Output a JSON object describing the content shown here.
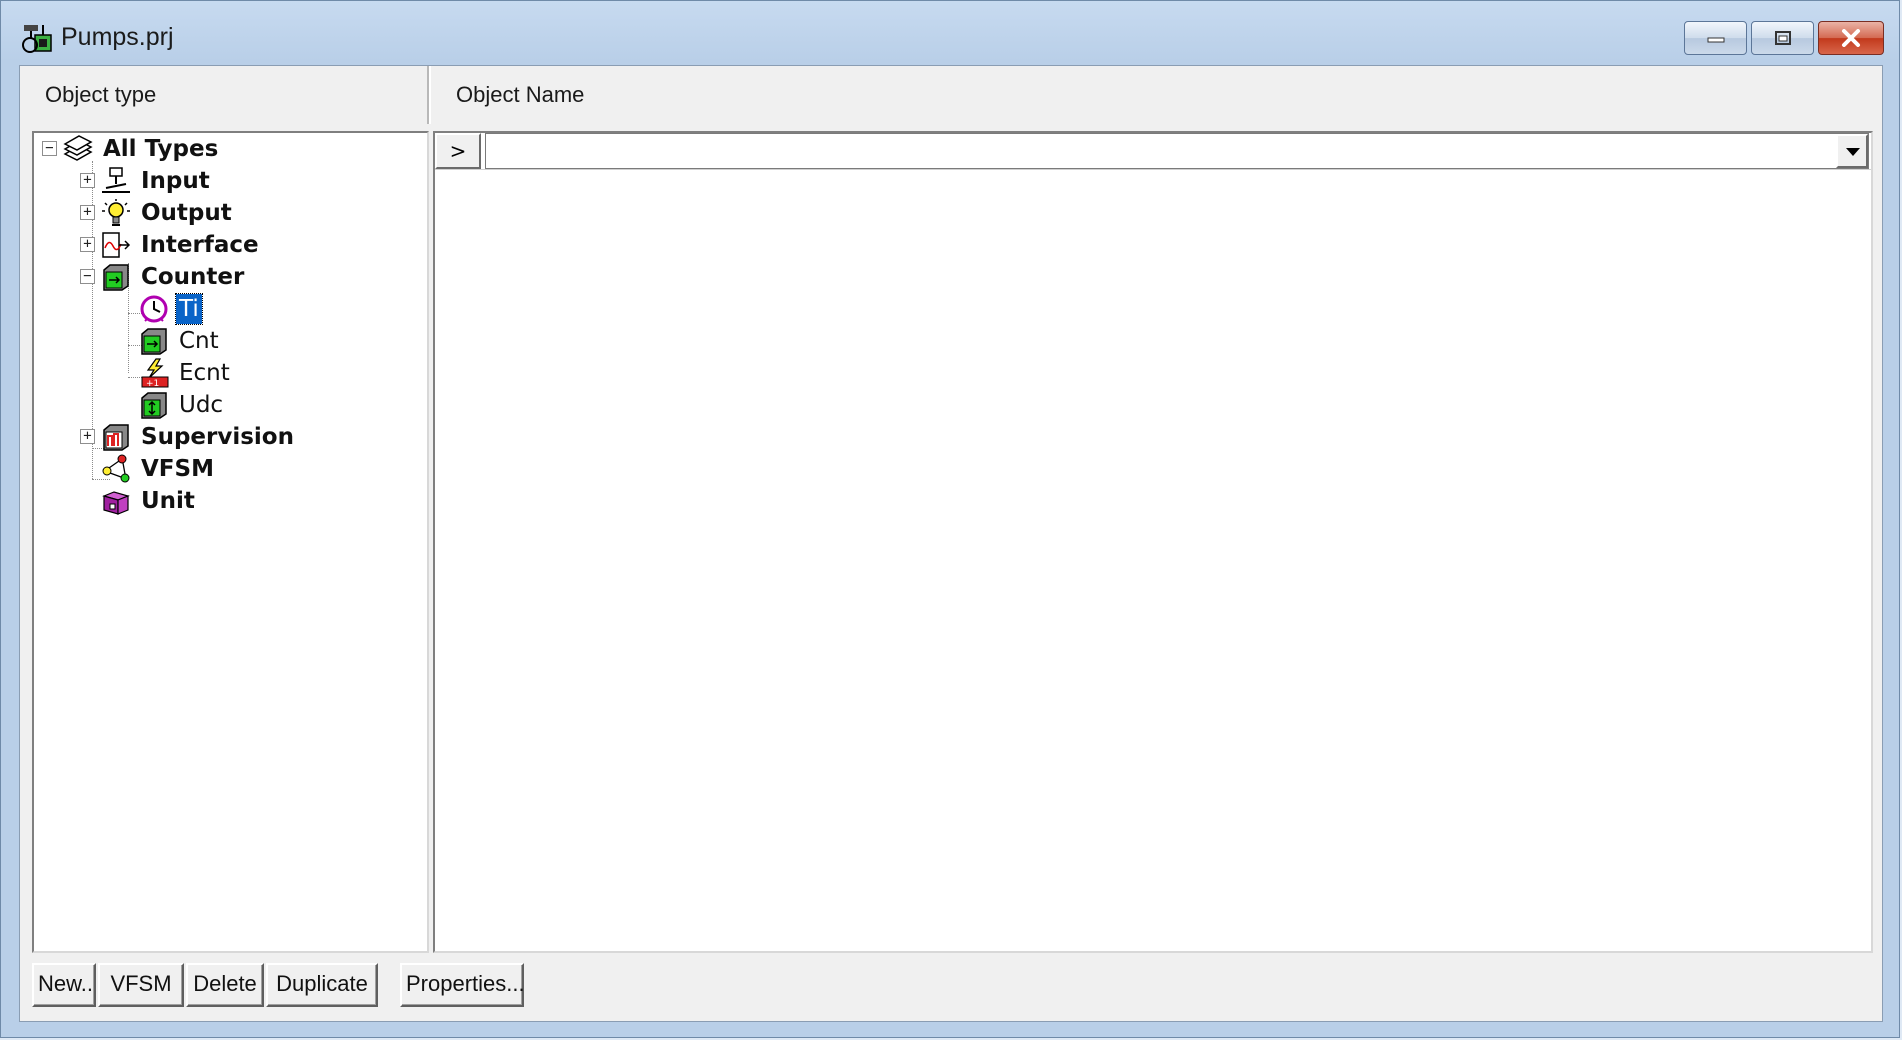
{
  "window": {
    "title": "Pumps.prj"
  },
  "headers": {
    "object_type": "Object type",
    "object_name": "Object Name"
  },
  "tree": {
    "root": "All Types",
    "nodes": [
      "Input",
      "Output",
      "Interface",
      "Counter",
      "Supervision",
      "VFSM",
      "Unit"
    ],
    "counter_children": [
      "Ti",
      "Cnt",
      "Ecnt",
      "Udc"
    ]
  },
  "object_name": {
    "go_label": ">",
    "value": ""
  },
  "buttons": {
    "new": "New..",
    "vfsm": "VFSM",
    "delete": "Delete",
    "duplicate": "Duplicate",
    "properties": "Properties..."
  },
  "colors": {
    "selection": "#0a64c8",
    "close_button": "#c2391c"
  }
}
